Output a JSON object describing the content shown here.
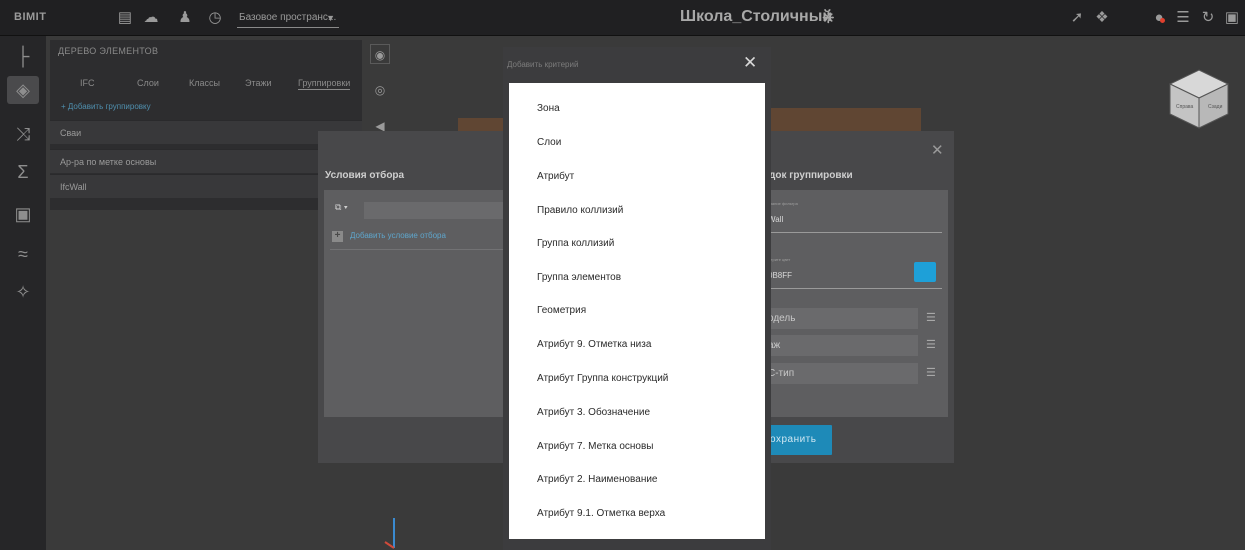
{
  "app": {
    "logo": "BIMIT",
    "space_select": "Базовое пространс...",
    "project_title": "Школа_Столичный"
  },
  "topbar_icons": [
    "briefcase-icon",
    "cloud-icon",
    "users-icon",
    "history-icon",
    "gear-icon",
    "cursor-icon",
    "rotate-icon",
    "bell-icon",
    "list-icon",
    "refresh-icon",
    "save-icon"
  ],
  "notification_color": "#e0402e",
  "rail": {
    "items": [
      "tree-icon",
      "model-icon",
      "shuffle-icon",
      "sigma-icon",
      "image-icon",
      "chart-icon",
      "puzzle-icon"
    ]
  },
  "tree": {
    "title": "ДЕРЕВО ЭЛЕМЕНТОВ",
    "tabs": [
      "IFC",
      "Слои",
      "Классы",
      "Этажи",
      "Группировки"
    ],
    "add_group": "+ Добавить группировку",
    "rows": [
      "Сваи",
      "Ар-ра по метке основы",
      "IfcWall"
    ]
  },
  "selection_dialog": {
    "title": "Условия отбора",
    "add_condition": "Добавить условие отбора"
  },
  "group_dialog": {
    "title": "док группировки",
    "filter_label": "звание фильтра",
    "filter_value": "Wall",
    "color_label": "берите цвет",
    "color_value": "0B8FF",
    "swatch_color": "#1ea0d8",
    "items": [
      "одель",
      "аж",
      "С-тип"
    ],
    "save": "охранить"
  },
  "criteria_dialog": {
    "title": "Добавить критерий",
    "items": [
      "Зона",
      "Слои",
      "Атрибут",
      "Правило коллизий",
      "Группа коллизий",
      "Группа элементов",
      "Геометрия",
      "Атрибут 9. Отметка низа",
      "Атрибут Группа конструкций",
      "Атрибут 3. Обозначение",
      "Атрибут 7. Метка основы",
      "Атрибут 2. Наименование",
      "Атрибут 9.1. Отметка верха"
    ]
  },
  "view_cube": {
    "face_left": "Справа",
    "face_right": "Сзади"
  }
}
